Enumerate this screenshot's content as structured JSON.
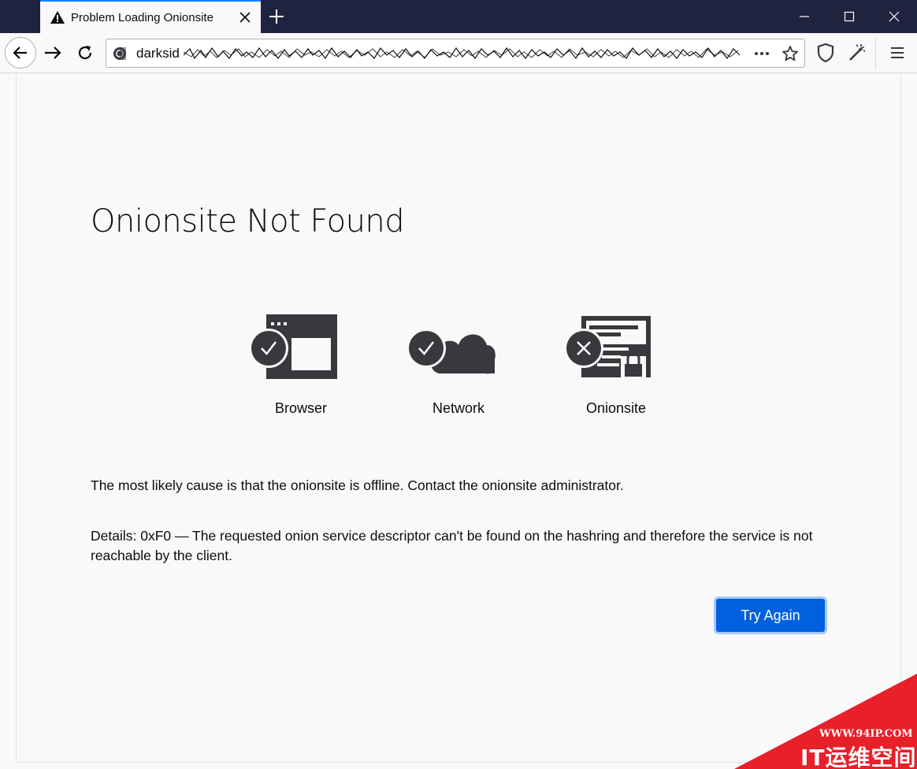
{
  "tab": {
    "title": "Problem Loading Onionsite"
  },
  "urlbar": {
    "visible_text": "darksid"
  },
  "page": {
    "title": "Onionsite Not Found",
    "status": [
      {
        "label": "Browser",
        "state": "ok",
        "icon": "browser-window-icon"
      },
      {
        "label": "Network",
        "state": "ok",
        "icon": "cloud-icon"
      },
      {
        "label": "Onionsite",
        "state": "error",
        "icon": "onionsite-lock-icon"
      }
    ],
    "description": "The most likely cause is that the onionsite is offline. Contact the onionsite administrator.",
    "details": "Details: 0xF0 — The requested onion service descriptor can't be found on the hashring and therefore the service is not reachable by the client.",
    "try_again": "Try Again"
  },
  "watermark": {
    "url": "WWW.94IP.COM",
    "brand": "IT运维空间"
  },
  "colors": {
    "titlebar": "#202340",
    "accent": "#0a84ff",
    "button": "#0060df",
    "icon_dark": "#38383d",
    "watermark_red": "#e8202a"
  }
}
